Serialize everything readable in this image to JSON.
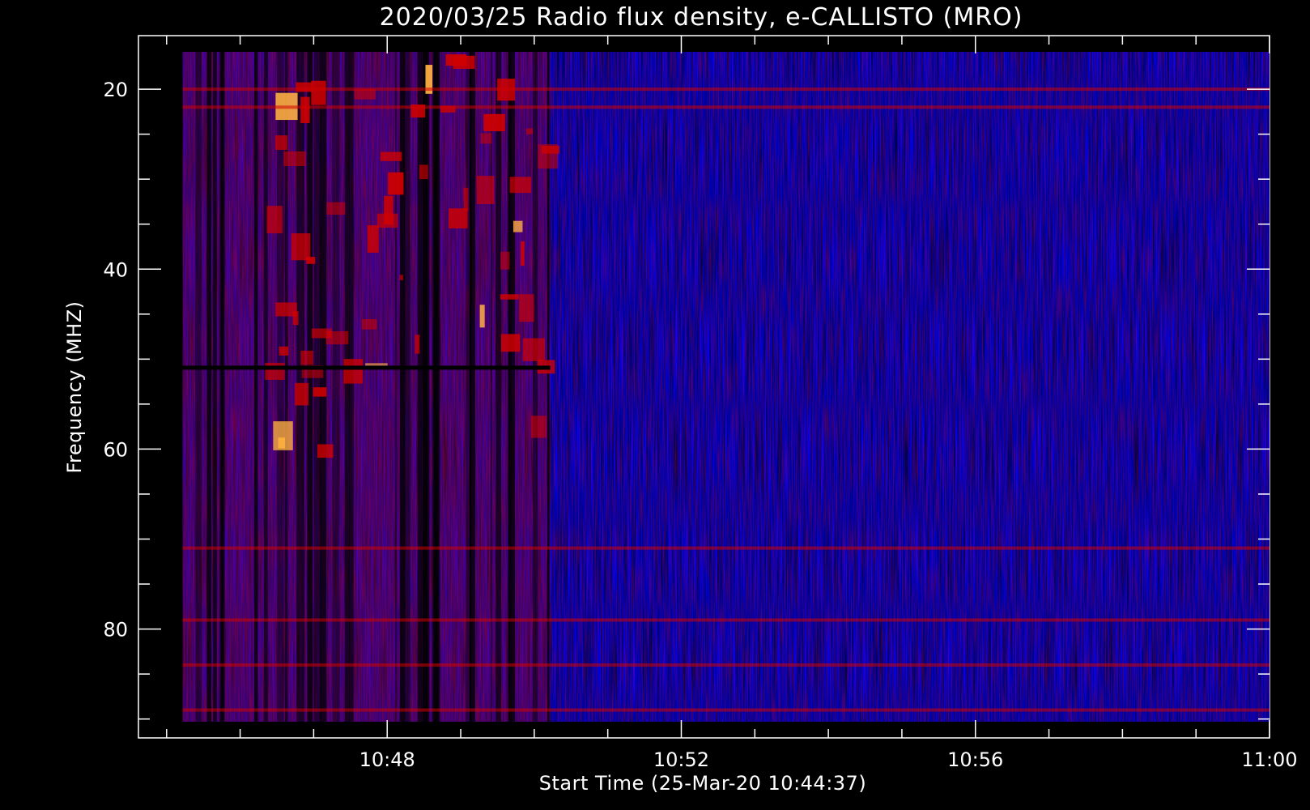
{
  "chart_data": {
    "type": "heatmap",
    "title": "2020/03/25  Radio flux density, e-CALLISTO (MRO)",
    "xlabel": "Start Time (25-Mar-20 10:44:37)",
    "ylabel": "Frequency (MHZ)",
    "x_tick_labels": [
      "10:48",
      "10:52",
      "10:56",
      "11:00"
    ],
    "y_tick_labels": [
      "20",
      "40",
      "60",
      "80"
    ],
    "start_time": "10:44:37",
    "xlim_minutes": [
      0,
      15.383
    ],
    "ylim": [
      15.85,
      90.3
    ],
    "y_inverted": true,
    "x_tick_values_minutes": [
      3.383,
      7.383,
      11.383,
      15.383
    ],
    "y_tick_values": [
      20,
      40,
      60,
      80
    ],
    "data_xrange_minutes": [
      0.6,
      15.383
    ],
    "data_yrange": [
      15.85,
      90.3
    ],
    "colormap": [
      "#000000",
      "#0000ff",
      "#d00000",
      "#ffffff"
    ],
    "features": {
      "burst_interval_minutes": [
        0.6,
        5.6
      ],
      "dark_horizontal_band_mhz": 51,
      "interference_bands_mhz": [
        20,
        22,
        71,
        79,
        84,
        89
      ]
    },
    "grid": false,
    "legend": "none"
  }
}
